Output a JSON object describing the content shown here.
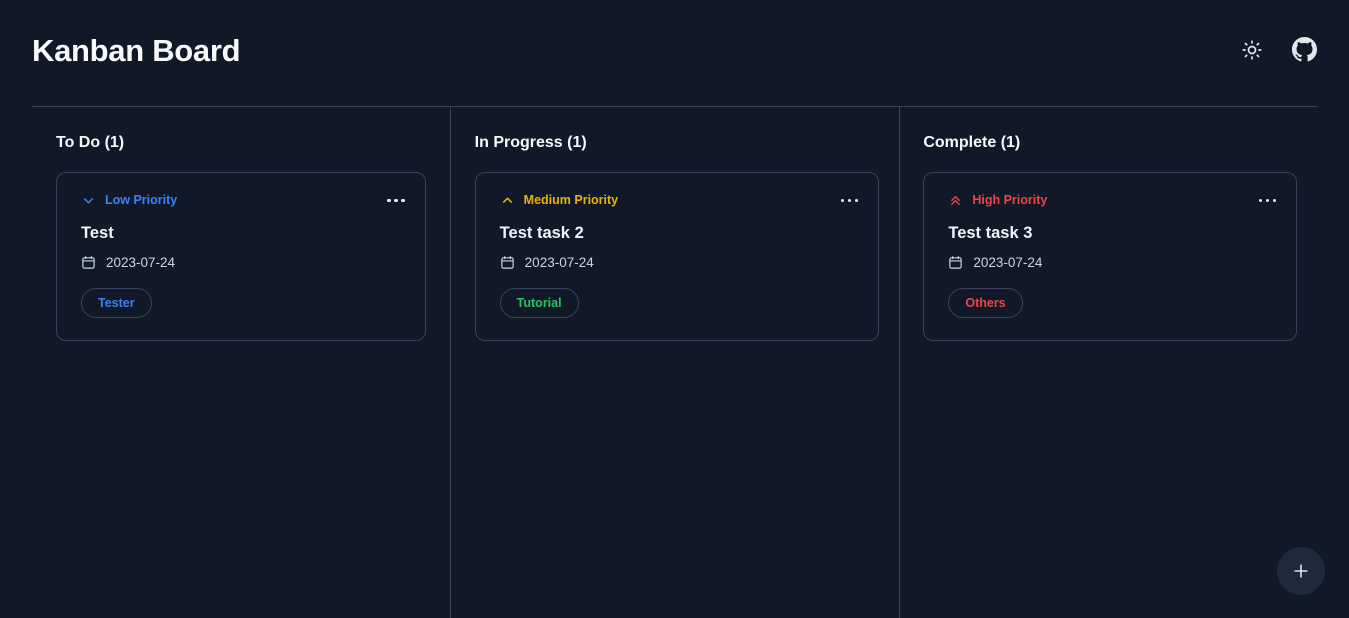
{
  "header": {
    "title": "Kanban Board",
    "theme_toggle_icon": "sun-icon",
    "github_icon": "github-icon"
  },
  "colors": {
    "background": "#111827",
    "border": "#39425a",
    "divider": "#3a4357",
    "low_priority": "#3b82f6",
    "medium_priority": "#eab308",
    "high_priority": "#ef4444",
    "tag_tester": "#3b82f6",
    "tag_tutorial": "#22c55e",
    "tag_others": "#ef4444",
    "fab_background": "#1e293b"
  },
  "board": {
    "columns": [
      {
        "title": "To Do (1)",
        "name": "todo",
        "cards": [
          {
            "priority_label": "Low Priority",
            "priority_level": "low",
            "priority_icon": "chevron-down-icon",
            "menu_icon": "ellipsis-icon",
            "title": "Test",
            "date": "2023-07-24",
            "date_icon": "calendar-icon",
            "tag": "Tester",
            "tag_color": "blue"
          }
        ]
      },
      {
        "title": "In Progress (1)",
        "name": "in-progress",
        "cards": [
          {
            "priority_label": "Medium Priority",
            "priority_level": "medium",
            "priority_icon": "chevron-up-icon",
            "menu_icon": "ellipsis-icon",
            "title": "Test task 2",
            "date": "2023-07-24",
            "date_icon": "calendar-icon",
            "tag": "Tutorial",
            "tag_color": "green"
          }
        ]
      },
      {
        "title": "Complete (1)",
        "name": "complete",
        "cards": [
          {
            "priority_label": "High Priority",
            "priority_level": "high",
            "priority_icon": "double-chevron-up-icon",
            "menu_icon": "ellipsis-icon",
            "title": "Test task 3",
            "date": "2023-07-24",
            "date_icon": "calendar-icon",
            "tag": "Others",
            "tag_color": "red"
          }
        ]
      }
    ]
  },
  "fab": {
    "icon": "plus-icon",
    "label": "+"
  }
}
